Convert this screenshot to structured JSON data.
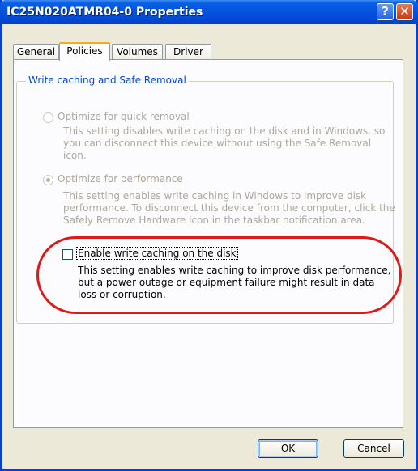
{
  "window": {
    "title": "IC25N020ATMR04-0 Properties",
    "help_glyph": "?",
    "close_glyph": "✕"
  },
  "tabs": [
    {
      "label": "General",
      "active": false
    },
    {
      "label": "Policies",
      "active": true
    },
    {
      "label": "Volumes",
      "active": false
    },
    {
      "label": "Driver",
      "active": false
    }
  ],
  "group": {
    "title": "Write caching and Safe Removal",
    "option_quick": {
      "label": "Optimize for quick removal",
      "description": "This setting disables write caching on the disk and in Windows, so you can disconnect this device without using the Safe Removal icon.",
      "selected": false,
      "enabled": false
    },
    "option_performance": {
      "label": "Optimize for performance",
      "description": "This setting enables write caching in Windows to improve disk performance. To disconnect this device from the computer, click the Safely Remove Hardware icon in the taskbar notification area.",
      "selected": true,
      "enabled": false
    },
    "write_cache": {
      "label": "Enable write caching on the disk",
      "description": "This setting enables write caching to improve disk performance, but a power outage or equipment failure might result in data loss or corruption.",
      "checked": false
    }
  },
  "buttons": {
    "ok": "OK",
    "cancel": "Cancel"
  },
  "colors": {
    "titlebar": "#0455e0",
    "highlight_ring": "#e01818",
    "group_title": "#0046d5",
    "disabled_text": "#aca899"
  }
}
